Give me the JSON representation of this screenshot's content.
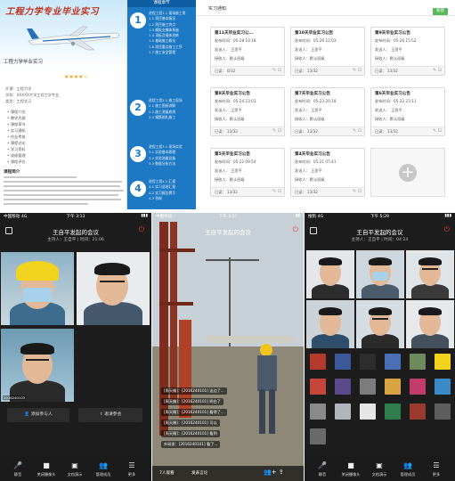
{
  "course": {
    "banner_title": "工程力学专业毕业实习",
    "banner_subtitle": "工程力学毕业实习",
    "rating_stars": "★★★★☆",
    "meta_lines": [
      "开课：工程力学",
      "学校：XXXXX大学工程力学专业",
      "类型：工程实习"
    ],
    "outline_items": [
      "课程介绍",
      "教学大纲",
      "课程章节",
      "实习通知",
      "作业考核",
      "课程讨论",
      "学习资料",
      "成绩管理",
      "课程评价"
    ],
    "intro_title": "课程简介"
  },
  "chapters": {
    "header": "课程章节",
    "items": [
      {
        "num": "1",
        "lines": [
          "进程工程1.1  现场施工常",
          "1.1  项目基本情况",
          "1.2  项目施工特点",
          "1.3  模板支撑体系施",
          "1.4  顶板及墙体浇筑",
          "1.5  基础施工概况",
          "1.6  项目重点施工工序",
          "1.7  施工安全管理"
        ]
      },
      {
        "num": "2",
        "lines": [
          "进程工程2.1  施工现场",
          "2.1  施工图纸讲解",
          "2.2  施工测量放线",
          "2.3  钢筋绑扎施工"
        ]
      },
      {
        "num": "3",
        "lines": [
          "进程工程3.1  现场实验",
          "3.1  实验基本原理",
          "3.2  实验测量设备",
          "3.3  数据分析方法"
        ]
      },
      {
        "num": "4",
        "lines": [
          "进程工程4.1  汇报",
          "4.1  实习总结汇报",
          "4.2  实习报告撰写",
          "4.3  答辩"
        ]
      }
    ]
  },
  "notices": {
    "title": "实习通知",
    "new_label": "新建",
    "cards": [
      {
        "title": "第11天毕业实习公...",
        "time": "发布时间：05-28 10:18",
        "sender": "发送人：  王思平",
        "recv": "接收人：默认班级",
        "read": "已读：  0/32"
      },
      {
        "title": "第10天毕业实习公告",
        "time": "发布时间：05-26 22:03",
        "sender": "发送人：  王思平",
        "recv": "接收人：默认班级",
        "read": "已读：  13/32"
      },
      {
        "title": "第9天毕业实习公告",
        "time": "发布时间：05-26 15:52",
        "sender": "发送人：  王思平",
        "recv": "接收人：默认班级",
        "read": "已读：  13/32"
      },
      {
        "title": "第8天毕业实习公告",
        "time": "发布时间：05-24 23:03",
        "sender": "发送人：  王思平",
        "recv": "接收人：默认班级",
        "read": "已读：  13/32"
      },
      {
        "title": "第7天毕业实习公告",
        "time": "发布时间：05-23 20:18",
        "sender": "发送人：  王思平",
        "recv": "接收人：默认班级",
        "read": "已读：  13/32"
      },
      {
        "title": "第6天毕业实习公告",
        "time": "发布时间：05-22 23:11",
        "sender": "发送人：  王思平",
        "recv": "接收人：默认班级",
        "read": "已读：  13/32"
      },
      {
        "title": "第5天毕业实习公告",
        "time": "发布时间：05-22 09:54",
        "sender": "发送人：  王思平",
        "recv": "接收人：默认班级",
        "read": "已读：  13/32"
      },
      {
        "title": "第4天毕业实习公告",
        "time": "发布时间：05-21 07:41",
        "sender": "发送人：  王思平",
        "recv": "接收人：默认班级",
        "read": "已读：  13/32"
      }
    ],
    "add_symbol": "+"
  },
  "phone1": {
    "status_left": "中国移动 4G",
    "status_time": "下午 3:13",
    "status_right": "▮▮▮",
    "meeting_title": "王自平发起的会议",
    "meeting_sub": "主持人：王自平 | 时间：21:06",
    "tile_labels": [
      "",
      "",
      "2016240103"
    ],
    "btn_add": "添加参与人",
    "btn_invite": "邀请参会",
    "toolbar": [
      {
        "icon": "🎤",
        "label": "静音"
      },
      {
        "icon": "■",
        "label": "关闭摄像头"
      },
      {
        "icon": "▣",
        "label": "文档演示"
      },
      {
        "icon": "👥",
        "label": "管理成员"
      },
      {
        "icon": "☰",
        "label": "更多"
      }
    ]
  },
  "phone2": {
    "status_left": "中国移动",
    "status_time": "下午 3:57",
    "status_right": "▮▮",
    "meeting_title": "王自平发起的会议",
    "chats": [
      "[周天赐]：[2016240101] 这边了...",
      "[周天赐]：[2016240101] 明白了",
      "[周天赐]：[2016240101] 看得了...",
      "[周天赐]：[2016240101] 可以",
      "[周天赐]：[2016240101] 看到",
      "外研发：[2016240101] 看了..."
    ],
    "people": "7人观看",
    "comment": "发表言论",
    "icons": "👥+  ⇪"
  },
  "phone3": {
    "status_left": "搜狗 4G",
    "status_time": "下午 5:29",
    "status_right": "▮▮▮",
    "meeting_title": "王自平发起的会议",
    "meeting_sub": "主持人：王自平 | 时间：04:24",
    "toolbar": [
      {
        "icon": "🎤",
        "label": "静音"
      },
      {
        "icon": "■",
        "label": "关闭摄像头"
      },
      {
        "icon": "▣",
        "label": "文档演示"
      },
      {
        "icon": "👥",
        "label": "管理成员"
      },
      {
        "icon": "☰",
        "label": "更多"
      }
    ]
  }
}
